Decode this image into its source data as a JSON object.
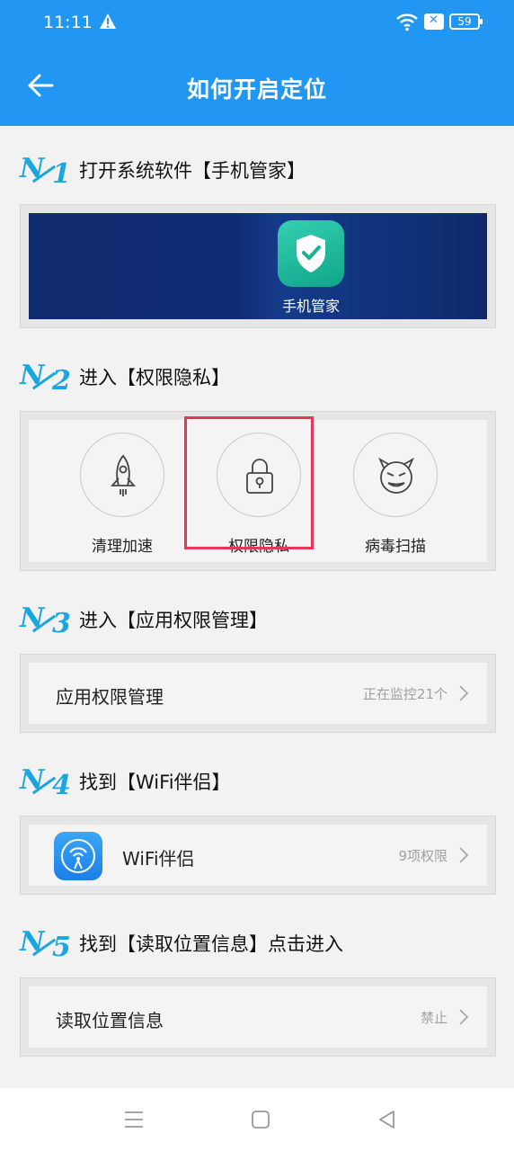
{
  "status": {
    "time": "11:11",
    "battery": "59"
  },
  "header": {
    "title": "如何开启定位"
  },
  "steps": [
    {
      "num": "1",
      "label": "打开系统软件【手机管家】",
      "banner_app": "手机管家"
    },
    {
      "num": "2",
      "label": "进入【权限隐私】",
      "features": [
        {
          "label": "清理加速",
          "icon": "rocket-icon"
        },
        {
          "label": "权限隐私",
          "icon": "lock-icon",
          "highlighted": true
        },
        {
          "label": "病毒扫描",
          "icon": "devil-face-icon"
        }
      ]
    },
    {
      "num": "3",
      "label": "进入【应用权限管理】",
      "row": {
        "label": "应用权限管理",
        "right": "正在监控21个"
      }
    },
    {
      "num": "4",
      "label": "找到【WiFi伴侣】",
      "row": {
        "label": "WiFi伴侣",
        "right": "9项权限"
      }
    },
    {
      "num": "5",
      "label": "找到【读取位置信息】点击进入",
      "row": {
        "label": "读取位置信息",
        "right": "禁止"
      }
    }
  ],
  "badge_prefix": "No",
  "colors": {
    "primary": "#2196f3",
    "badge": "#1aa7e0",
    "highlight": "#e8355a"
  }
}
